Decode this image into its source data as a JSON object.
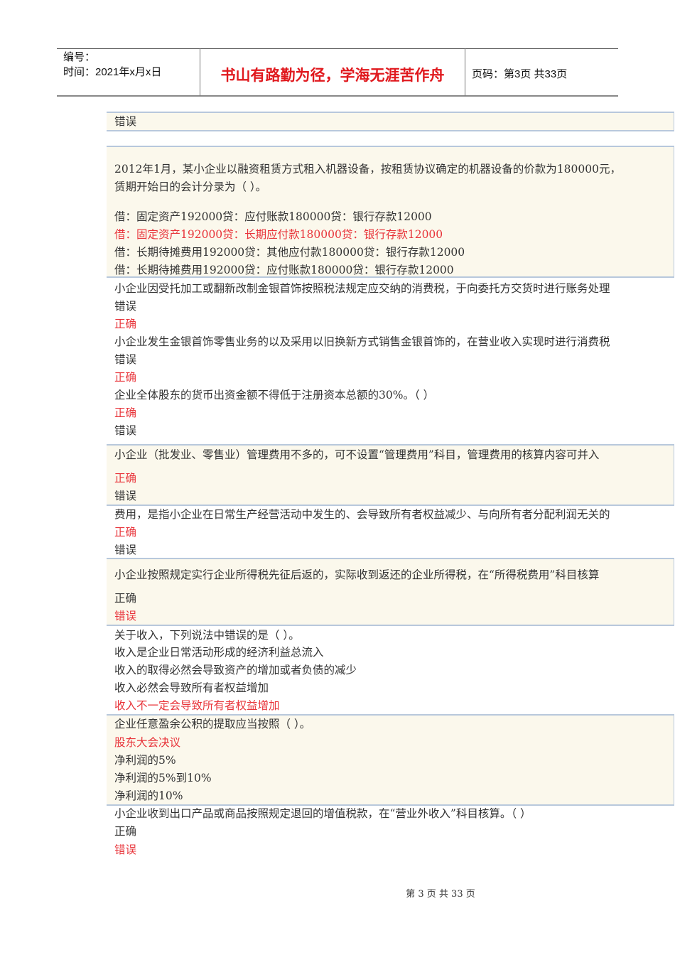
{
  "header": {
    "number_label": "编号：",
    "date_label": "时间：2021年x月x日",
    "motto": "书山有路勤为径，学海无涯苦作舟",
    "page_label": "页码：第3页  共33页"
  },
  "lines": [
    {
      "text": "错误",
      "red": false
    },
    {
      "text": "2012年1月，某小企业以融资租赁方式租入机器设备，按租赁协议确定的机器设备的价款为180000元，",
      "red": false
    },
    {
      "text": "赁期开始日的会计分录为（ ）。",
      "red": false
    },
    {
      "text": "借：固定资产192000贷：应付账款180000贷：银行存款12000",
      "red": false
    },
    {
      "text": "借：固定资产192000贷：长期应付款180000贷：银行存款12000",
      "red": true
    },
    {
      "text": "借：长期待摊费用192000贷：其他应付款180000贷：银行存款12000",
      "red": false
    },
    {
      "text": "借：长期待摊费用192000贷：应付账款180000贷：银行存款12000",
      "red": false
    },
    {
      "text": "小企业因受托加工或翻新改制金银首饰按照税法规定应交纳的消费税，于向委托方交货时进行账务处理",
      "red": false
    },
    {
      "text": "错误",
      "red": false
    },
    {
      "text": "正确",
      "red": true
    },
    {
      "text": "小企业发生金银首饰零售业务的以及采用以旧换新方式销售金银首饰的，在营业收入实现时进行消费税",
      "red": false
    },
    {
      "text": "错误",
      "red": false
    },
    {
      "text": "正确",
      "red": true
    },
    {
      "text": "企业全体股东的货币出资金额不得低于注册资本总额的30%。（ ）",
      "red": false
    },
    {
      "text": "正确",
      "red": true
    },
    {
      "text": "错误",
      "red": false
    },
    {
      "text": "小企业（批发业、零售业）管理费用不多的，可不设置“管理费用”科目，管理费用的核算内容可并入",
      "red": false
    },
    {
      "text": "正确",
      "red": true
    },
    {
      "text": "错误",
      "red": false
    },
    {
      "text": "费用，是指小企业在日常生产经营活动中发生的、会导致所有者权益减少、与向所有者分配利润无关的",
      "red": false
    },
    {
      "text": "正确",
      "red": true
    },
    {
      "text": "错误",
      "red": false
    },
    {
      "text": "小企业按照规定实行企业所得税先征后返的，实际收到返还的企业所得税，在“所得税费用”科目核算",
      "red": false
    },
    {
      "text": "正确",
      "red": false
    },
    {
      "text": "错误",
      "red": true
    },
    {
      "text": "关于收入，下列说法中错误的是（ ）。",
      "red": false
    },
    {
      "text": "收入是企业日常活动形成的经济利益总流入",
      "red": false
    },
    {
      "text": "收入的取得必然会导致资产的增加或者负债的减少",
      "red": false
    },
    {
      "text": "收入必然会导致所有者权益增加",
      "red": false
    },
    {
      "text": "收入不一定会导致所有者权益增加",
      "red": true
    },
    {
      "text": "企业任意盈余公积的提取应当按照（ ）。",
      "red": false
    },
    {
      "text": "股东大会决议",
      "red": true
    },
    {
      "text": "净利润的5%",
      "red": false
    },
    {
      "text": "净利润的5%到10%",
      "red": false
    },
    {
      "text": "净利润的10%",
      "red": false
    },
    {
      "text": "小企业收到出口产品或商品按照规定退回的增值税款，在“营业外收入”科目核算。（ ）",
      "red": false
    },
    {
      "text": "正确",
      "red": false
    },
    {
      "text": "错误",
      "red": true
    }
  ],
  "footer": "第 3 页 共 33 页"
}
